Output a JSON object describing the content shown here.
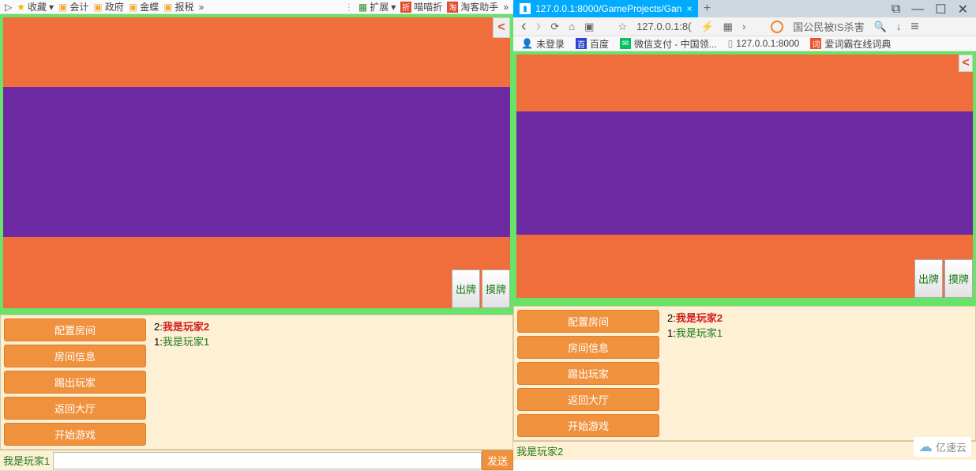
{
  "left": {
    "toolbar": {
      "fav": "收藏",
      "folders": [
        "会计",
        "政府",
        "金蝶",
        "报税"
      ],
      "more": "»",
      "ext": "扩展",
      "miaomiao": "喵喵折",
      "taoke": "淘客助手",
      "fold_icon": "折"
    },
    "game": {
      "play_card": "出牌",
      "draw_card": "摸牌"
    },
    "lobby": {
      "buttons": [
        "配置房间",
        "房间信息",
        "踢出玩家",
        "返回大厅",
        "开始游戏"
      ],
      "players": [
        {
          "idx": "2:",
          "name": "我是玩家2",
          "cls": "pl-red"
        },
        {
          "idx": "1:",
          "name": "我是玩家1",
          "cls": "pl-green"
        }
      ]
    },
    "me": "我是玩家1",
    "send": "发送",
    "status_items": [
      "",
      "",
      "",
      "",
      "",
      "",
      "",
      "",
      ""
    ]
  },
  "right": {
    "tab": {
      "title": "127.0.0.1:8000/GameProjects/Gan",
      "close": "×"
    },
    "newtab": "+",
    "win": {
      "pin": "⧉",
      "min": "—",
      "max": "☐",
      "close": "✕"
    },
    "addr": {
      "back": "‹",
      "fwd": "›",
      "reload": "⟳",
      "home": "⌂",
      "panel": "▣",
      "star": "☆",
      "text": "127.0.0.1:8(",
      "flash": "⚡",
      "grid": "▦",
      "arrow": "›",
      "newslabel": "国公民被IS杀害",
      "search": "🔍",
      "down": "↓",
      "menu": "≡"
    },
    "bm": {
      "nologin": "未登录",
      "baidu": "百度",
      "wx": "微信支付 - 中国领...",
      "local": "127.0.0.1:8000",
      "dict": "爱词霸在线词典"
    },
    "game": {
      "play_card": "出牌",
      "draw_card": "摸牌"
    },
    "lobby": {
      "buttons": [
        "配置房间",
        "房间信息",
        "踢出玩家",
        "返回大厅",
        "开始游戏"
      ],
      "players": [
        {
          "idx": "2:",
          "name": "我是玩家2",
          "cls": "pl-red"
        },
        {
          "idx": "1:",
          "name": "我是玩家1",
          "cls": "pl-green"
        }
      ]
    },
    "me": "我是玩家2",
    "brand": "亿速云"
  }
}
